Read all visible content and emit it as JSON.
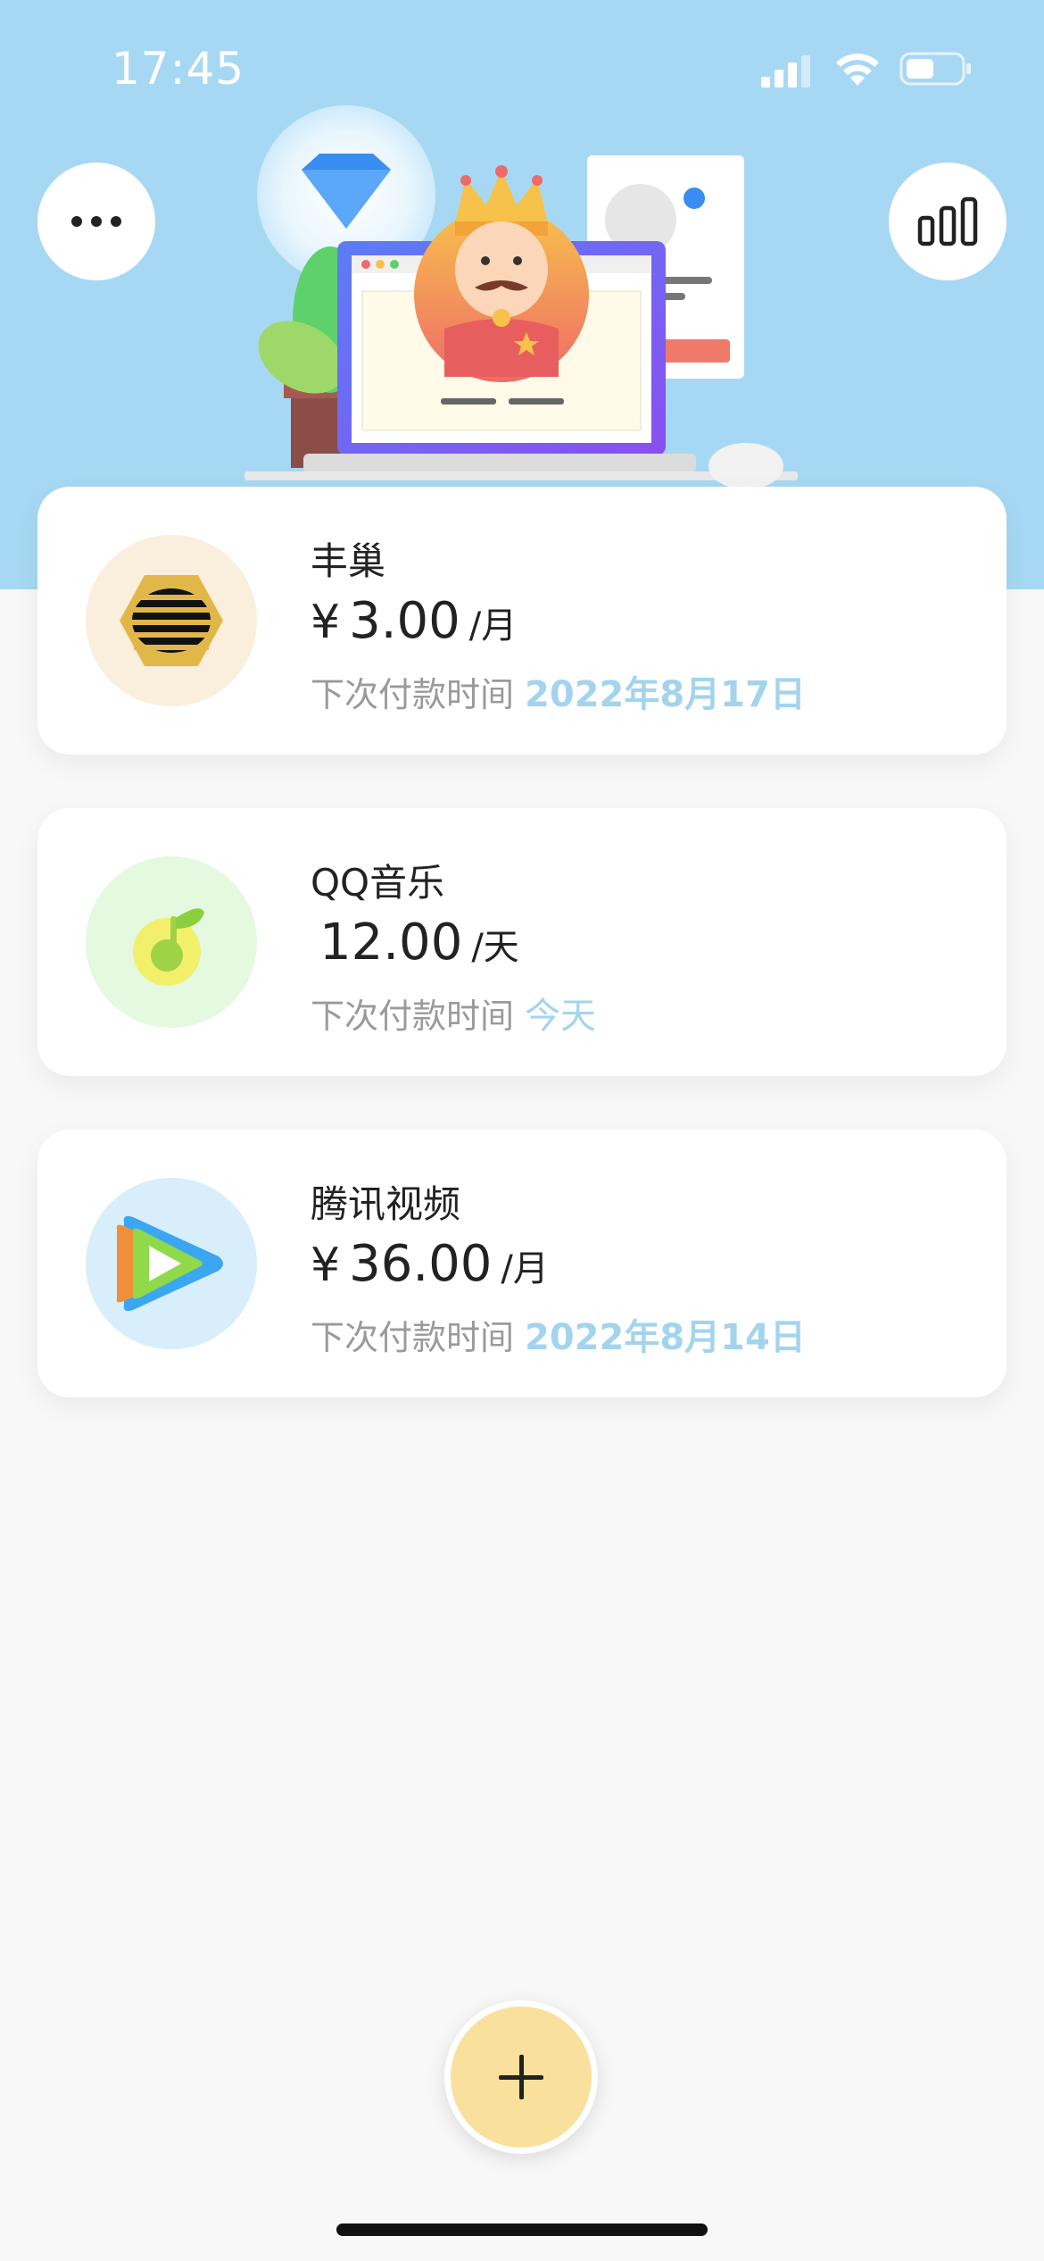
{
  "status_bar": {
    "time": "17:45"
  },
  "header": {
    "more_icon": "more-icon",
    "stats_icon": "bar-chart-icon",
    "illustration": "crowned-king-laptop-illustration"
  },
  "subscriptions": [
    {
      "name": "丰巢",
      "currency": "¥",
      "amount": "3.00",
      "unit": "/月",
      "next_label": "下次付款时间",
      "next_date": "2022年8月17日",
      "logo_icon": "fengchao-logo-icon",
      "logo_bg": "#faefdd"
    },
    {
      "name": "QQ音乐",
      "currency": "",
      "amount": "12.00",
      "unit": "/天",
      "next_label": "下次付款时间",
      "next_date": "今天",
      "logo_icon": "qq-music-logo-icon",
      "logo_bg": "#e4f9df"
    },
    {
      "name": "腾讯视频",
      "currency": "¥",
      "amount": "36.00",
      "unit": "/月",
      "next_label": "下次付款时间",
      "next_date": "2022年8月14日",
      "logo_icon": "tencent-video-logo-icon",
      "logo_bg": "#d8eefa"
    }
  ],
  "add_button_icon": "plus-icon",
  "colors": {
    "header_bg": "#a7d8f3",
    "accent_date": "#a3d4ee",
    "add_button": "#f9e09c"
  }
}
